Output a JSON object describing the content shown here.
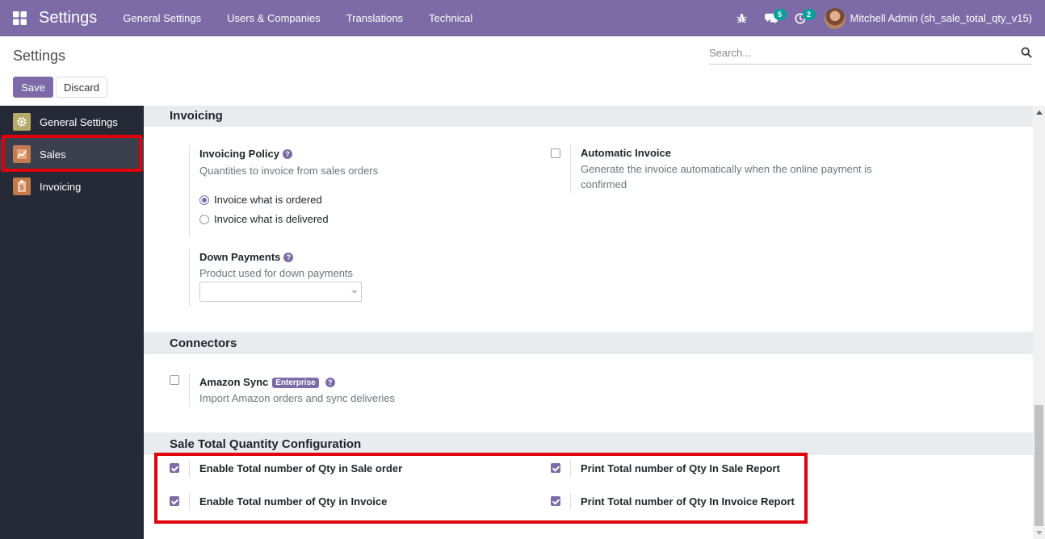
{
  "navbar": {
    "brand": "Settings",
    "menu": [
      "General Settings",
      "Users & Companies",
      "Translations",
      "Technical"
    ],
    "messages_count": "5",
    "activities_count": "2",
    "user_name": "Mitchell Admin (sh_sale_total_qty_v15)"
  },
  "control_panel": {
    "title": "Settings",
    "search_placeholder": "Search...",
    "save_label": "Save",
    "discard_label": "Discard"
  },
  "sidebar": {
    "items": [
      {
        "label": "General Settings",
        "icon": "gear-icon"
      },
      {
        "label": "Sales",
        "icon": "sales-chart-icon",
        "active": true
      },
      {
        "label": "Invoicing",
        "icon": "invoice-icon"
      }
    ]
  },
  "invoicing": {
    "heading": "Invoicing",
    "policy_label": "Invoicing Policy",
    "policy_desc": "Quantities to invoice from sales orders",
    "option_ordered": "Invoice what is ordered",
    "option_delivered": "Invoice what is delivered",
    "policy_selected": "Invoice what is ordered",
    "auto_invoice_label": "Automatic Invoice",
    "auto_invoice_desc": "Generate the invoice automatically when the online payment is confirmed",
    "auto_invoice_checked": false,
    "down_label": "Down Payments",
    "down_desc": "Product used for down payments",
    "down_value": ""
  },
  "connectors": {
    "heading": "Connectors",
    "amazon_label": "Amazon Sync",
    "amazon_badge": "Enterprise",
    "amazon_desc": "Import Amazon orders and sync deliveries",
    "amazon_checked": false
  },
  "sale_total_qty": {
    "heading": "Sale Total Quantity Configuration",
    "opt1": "Enable Total number of Qty in Sale order",
    "opt2": "Print Total number of Qty In Sale Report",
    "opt3": "Enable Total number of Qty in Invoice",
    "opt4": "Print Total number of Qty In Invoice Report",
    "all_checked": true
  },
  "colors": {
    "brand": "#7c6ba6",
    "sidebar": "#262a36",
    "highlight": "#e0000a",
    "badge": "#00a09d"
  }
}
